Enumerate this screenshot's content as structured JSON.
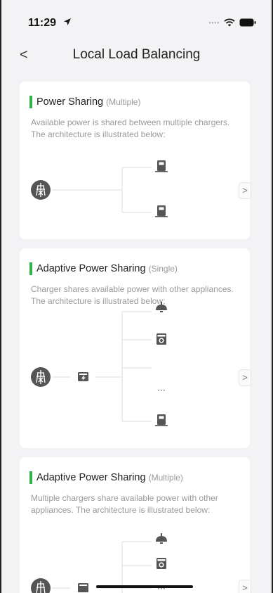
{
  "status": {
    "time": "11:29"
  },
  "nav": {
    "title": "Local Load Balancing",
    "back": "<"
  },
  "cards": [
    {
      "title": "Power Sharing",
      "tag": "(Multiple)",
      "description": "Available power is shared between multiple chargers. The architecture is illustrated below:"
    },
    {
      "title": "Adaptive Power Sharing",
      "tag": "(Single)",
      "description": "Charger shares available power with other appliances. The architecture is illustrated below:",
      "ellipsis": "···"
    },
    {
      "title": "Adaptive Power Sharing",
      "tag": "(Multiple)",
      "description": "Multiple chargers share available power with other appliances. The architecture is illustrated below:",
      "ellipsis": "···"
    }
  ],
  "chevron": ">",
  "colors": {
    "accent": "#2fb44a",
    "icon": "#555555",
    "line": "#dddddd"
  }
}
